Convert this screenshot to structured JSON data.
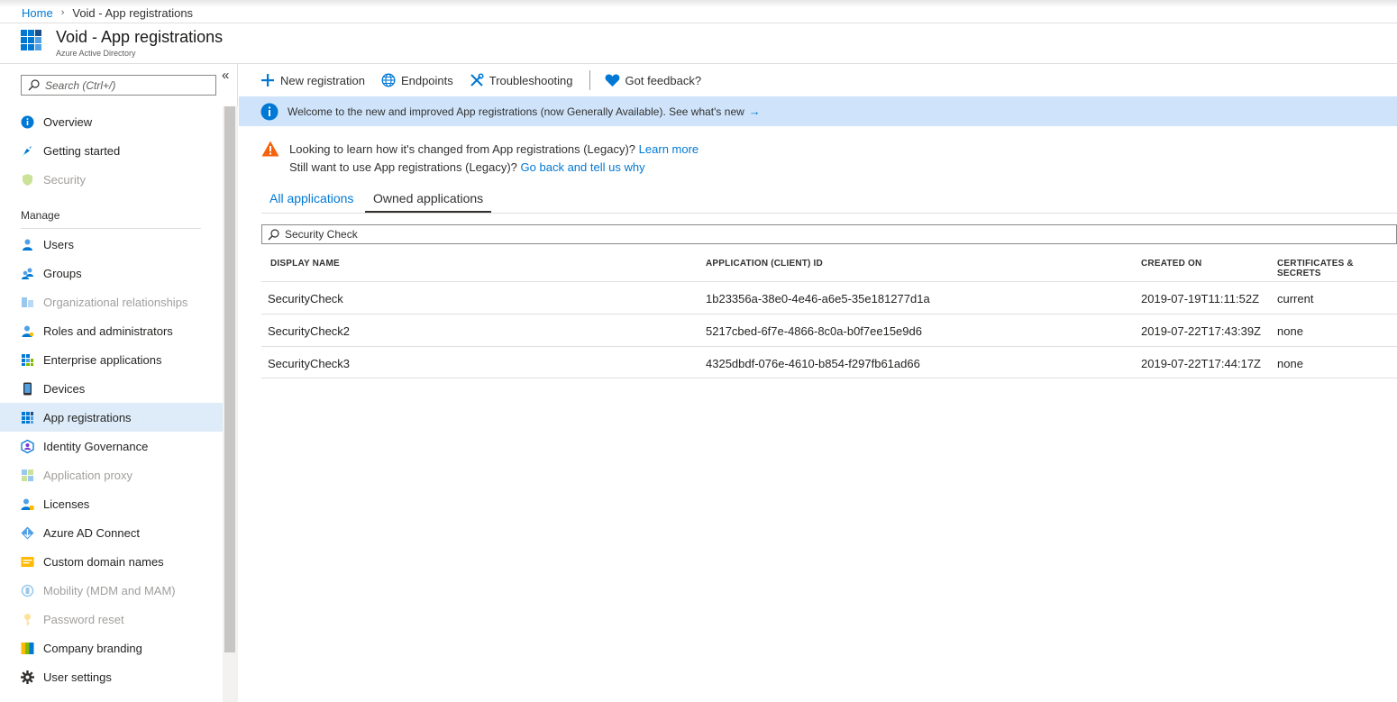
{
  "breadcrumb": {
    "home": "Home",
    "current": "Void - App registrations"
  },
  "header": {
    "title": "Void - App registrations",
    "subtitle": "Azure Active Directory"
  },
  "sidebar": {
    "search_placeholder": "Search (Ctrl+/)",
    "collapse": "«",
    "top_items": [
      {
        "label": "Overview",
        "icon": "info-icon",
        "disabled": false
      },
      {
        "label": "Getting started",
        "icon": "rocket-icon",
        "disabled": false
      },
      {
        "label": "Security",
        "icon": "shield-icon",
        "disabled": true
      }
    ],
    "section": "Manage",
    "manage_items": [
      {
        "label": "Users",
        "icon": "user-icon",
        "disabled": false
      },
      {
        "label": "Groups",
        "icon": "group-icon",
        "disabled": false
      },
      {
        "label": "Organizational relationships",
        "icon": "org-icon",
        "disabled": true
      },
      {
        "label": "Roles and administrators",
        "icon": "role-icon",
        "disabled": false
      },
      {
        "label": "Enterprise applications",
        "icon": "apps-icon",
        "disabled": false
      },
      {
        "label": "Devices",
        "icon": "device-icon",
        "disabled": false
      },
      {
        "label": "App registrations",
        "icon": "app-grid-icon",
        "disabled": false,
        "selected": true
      },
      {
        "label": "Identity Governance",
        "icon": "governance-icon",
        "disabled": false
      },
      {
        "label": "Application proxy",
        "icon": "proxy-icon",
        "disabled": true
      },
      {
        "label": "Licenses",
        "icon": "license-icon",
        "disabled": false
      },
      {
        "label": "Azure AD Connect",
        "icon": "connect-icon",
        "disabled": false
      },
      {
        "label": "Custom domain names",
        "icon": "domain-icon",
        "disabled": false
      },
      {
        "label": "Mobility (MDM and MAM)",
        "icon": "mobility-icon",
        "disabled": true
      },
      {
        "label": "Password reset",
        "icon": "key-icon",
        "disabled": true
      },
      {
        "label": "Company branding",
        "icon": "branding-icon",
        "disabled": false
      },
      {
        "label": "User settings",
        "icon": "gear-icon",
        "disabled": false
      }
    ]
  },
  "toolbar": {
    "new_registration": "New registration",
    "endpoints": "Endpoints",
    "troubleshooting": "Troubleshooting",
    "feedback": "Got feedback?"
  },
  "banner": {
    "text": "Welcome to the new and improved App registrations (now Generally Available). See what's new",
    "arrow": "→"
  },
  "legacy": {
    "line1": "Looking to learn how it's changed from App registrations (Legacy)?",
    "link1": "Learn more",
    "line2": "Still want to use App registrations (Legacy)?",
    "link2": "Go back and tell us why"
  },
  "tabs": {
    "all": "All applications",
    "owned": "Owned applications"
  },
  "filter": {
    "value": "Security Check"
  },
  "table": {
    "headers": [
      "DISPLAY NAME",
      "APPLICATION (CLIENT) ID",
      "CREATED ON",
      "CERTIFICATES & SECRETS"
    ],
    "rows": [
      [
        "SecurityCheck",
        "1b23356a-38e0-4e46-a6e5-35e181277d1a",
        "2019-07-19T11:11:52Z",
        "current"
      ],
      [
        "SecurityCheck2",
        "5217cbed-6f7e-4866-8c0a-b0f7ee15e9d6",
        "2019-07-22T17:43:39Z",
        "none"
      ],
      [
        "SecurityCheck3",
        "4325dbdf-076e-4610-b854-f297fb61ad66",
        "2019-07-22T17:44:17Z",
        "none"
      ]
    ]
  },
  "colors": {
    "accent": "#0078d4",
    "banner": "#cfe4fa",
    "selected": "#deecf9",
    "warning": "#f7630c"
  }
}
